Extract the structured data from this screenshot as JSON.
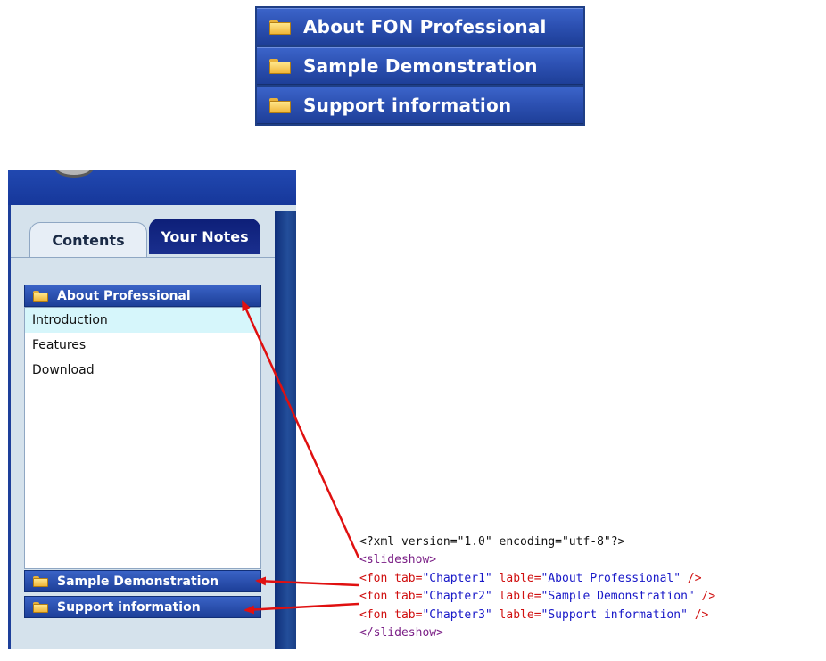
{
  "top_menu": {
    "items": [
      {
        "label": "About FON Professional",
        "icon": "folder-icon"
      },
      {
        "label": "Sample Demonstration",
        "icon": "folder-icon"
      },
      {
        "label": "Support information",
        "icon": "folder-icon"
      }
    ]
  },
  "player": {
    "tabs": {
      "contents": "Contents",
      "notes": "Your Notes"
    },
    "chapters": [
      {
        "label": "About Professional",
        "icon": "folder-icon"
      },
      {
        "label": "Sample Demonstration",
        "icon": "folder-icon"
      },
      {
        "label": "Support information",
        "icon": "folder-icon"
      }
    ],
    "items": [
      "Introduction",
      "Features",
      "Download"
    ],
    "selected_item": "Introduction"
  },
  "code": {
    "line1": "<?xml version=\"1.0\" encoding=\"utf-8\"?>",
    "open_tag": "<slideshow>",
    "close_tag": "</slideshow>",
    "entries": [
      {
        "tab": "Chapter1",
        "lable": "About Professional"
      },
      {
        "tab": "Chapter2",
        "lable": "Sample Demonstration"
      },
      {
        "tab": "Chapter3",
        "lable": "Support information"
      }
    ],
    "tokens": {
      "fon_open": "<fon",
      "tab_attr": " tab=",
      "lable_attr": " lable=",
      "self_close": " />"
    }
  },
  "colors": {
    "menu_blue": "#2d51b3",
    "arrow_red": "#e01010",
    "selected_row": "#d6f6fb"
  }
}
